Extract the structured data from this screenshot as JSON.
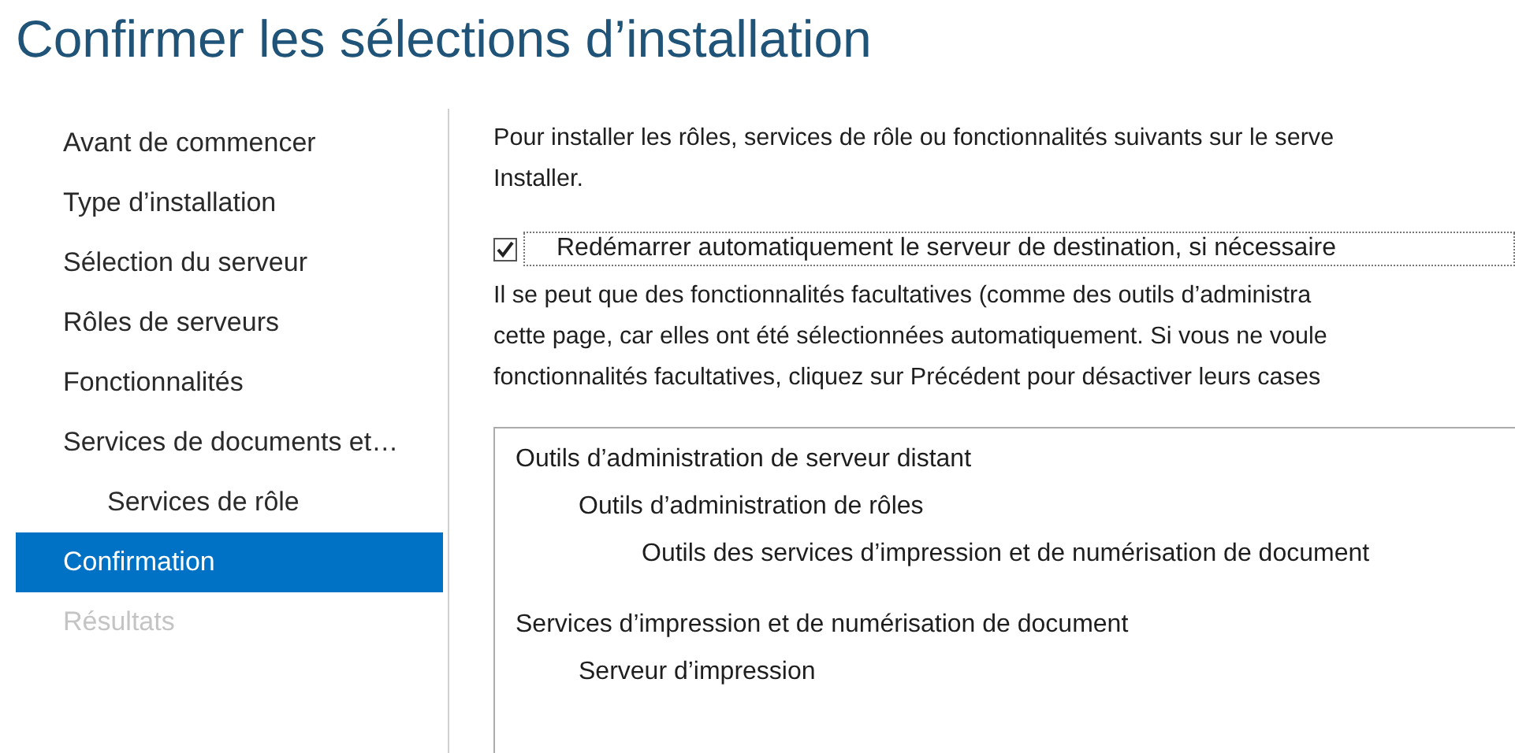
{
  "window": {
    "title": "Confirmer les sélections d’installation"
  },
  "sidebar": {
    "items": [
      {
        "label": "Avant de commencer",
        "selected": false,
        "disabled": false
      },
      {
        "label": "Type d’installation",
        "selected": false,
        "disabled": false
      },
      {
        "label": "Sélection du serveur",
        "selected": false,
        "disabled": false
      },
      {
        "label": "Rôles de serveurs",
        "selected": false,
        "disabled": false
      },
      {
        "label": "Fonctionnalités",
        "selected": false,
        "disabled": false
      },
      {
        "label": "Services de documents et…",
        "selected": false,
        "disabled": false,
        "children": [
          {
            "label": "Services de rôle",
            "selected": false,
            "disabled": false
          }
        ]
      },
      {
        "label": "Confirmation",
        "selected": true,
        "disabled": false
      },
      {
        "label": "Résultats",
        "selected": false,
        "disabled": true
      }
    ]
  },
  "intro": [
    "Pour installer les rôles, services de rôle ou fonctionnalités suivants sur le serve",
    "Installer."
  ],
  "restart_option": {
    "label": "Redémarrer automatiquement le serveur de destination, si nécessaire",
    "checked": true
  },
  "note": [
    "Il se peut que des fonctionnalités facultatives (comme des outils d’administra",
    "cette page, car elles ont été sélectionnées automatiquement. Si vous ne voule",
    "fonctionnalités facultatives, cliquez sur Précédent pour désactiver leurs cases"
  ],
  "selection_tree": [
    {
      "label": "Outils d’administration de serveur distant",
      "children": [
        {
          "label": "Outils d’administration de rôles",
          "children": [
            {
              "label": "Outils des services d’impression et de numérisation de document"
            }
          ]
        }
      ]
    },
    {
      "label": "Services d’impression et de numérisation de document",
      "children": [
        {
          "label": "Serveur d’impression"
        }
      ]
    }
  ]
}
